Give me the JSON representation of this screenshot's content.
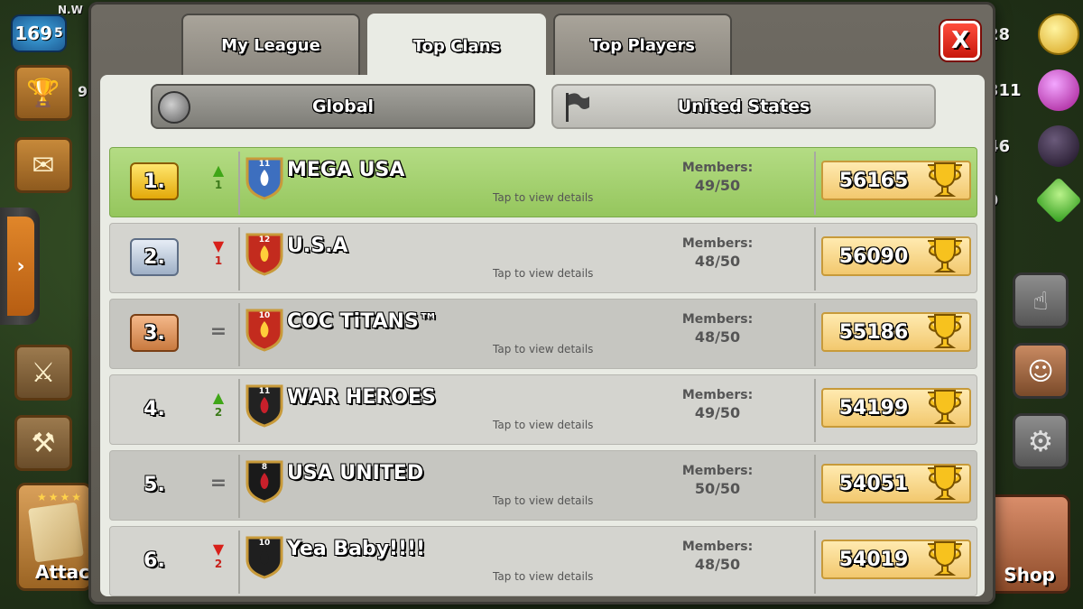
{
  "hud": {
    "player_name": "N.W",
    "level": "169",
    "level_suffix": "5",
    "trophies_partial": "9",
    "gold": "28",
    "elixir": "311",
    "dark_elixir": "46",
    "gems": "9",
    "attack_label": "Attac",
    "shop_label": "Shop"
  },
  "panel": {
    "tabs": [
      {
        "label": "My League",
        "active": false
      },
      {
        "label": "Top Clans",
        "active": true
      },
      {
        "label": "Top Players",
        "active": false
      }
    ],
    "close_label": "X",
    "filters": [
      {
        "label": "Global",
        "icon": "globe-icon",
        "active": true
      },
      {
        "label": "United States",
        "icon": "flag-icon",
        "active": false
      }
    ]
  },
  "rows_common": {
    "details_text": "Tap to view details",
    "members_label": "Members:"
  },
  "clans": [
    {
      "rank": "1.",
      "trend": "up",
      "trend_num": "1",
      "badge_level": "11",
      "name": "MEGA USA",
      "members": "49/50",
      "score": "56165"
    },
    {
      "rank": "2.",
      "trend": "down",
      "trend_num": "1",
      "badge_level": "12",
      "name": "U.S.A",
      "members": "48/50",
      "score": "56090"
    },
    {
      "rank": "3.",
      "trend": "same",
      "trend_num": "",
      "badge_level": "10",
      "name": "COC TiTANS™",
      "members": "48/50",
      "score": "55186"
    },
    {
      "rank": "4.",
      "trend": "up",
      "trend_num": "2",
      "badge_level": "11",
      "name": "WAR HEROES",
      "members": "49/50",
      "score": "54199"
    },
    {
      "rank": "5.",
      "trend": "same",
      "trend_num": "",
      "badge_level": "8",
      "name": "USA UNITED",
      "members": "50/50",
      "score": "54051"
    },
    {
      "rank": "6.",
      "trend": "down",
      "trend_num": "2",
      "badge_level": "10",
      "name": "Yea Baby!!!!",
      "members": "48/50",
      "score": "54019"
    }
  ],
  "symbols": {
    "up_arrow": "▲",
    "down_arrow": "▼",
    "equal": "=",
    "side_arrow": "›"
  },
  "colors": {
    "highlight_row": "#a8d474",
    "gold_rank": "#f2c12b",
    "silver_rank": "#b7c4d6",
    "bronze_rank": "#e09a62",
    "trend_up": "#3fa617",
    "trend_down": "#d8201a",
    "close_button": "#e4261a",
    "score_box": "#f7d98a"
  }
}
